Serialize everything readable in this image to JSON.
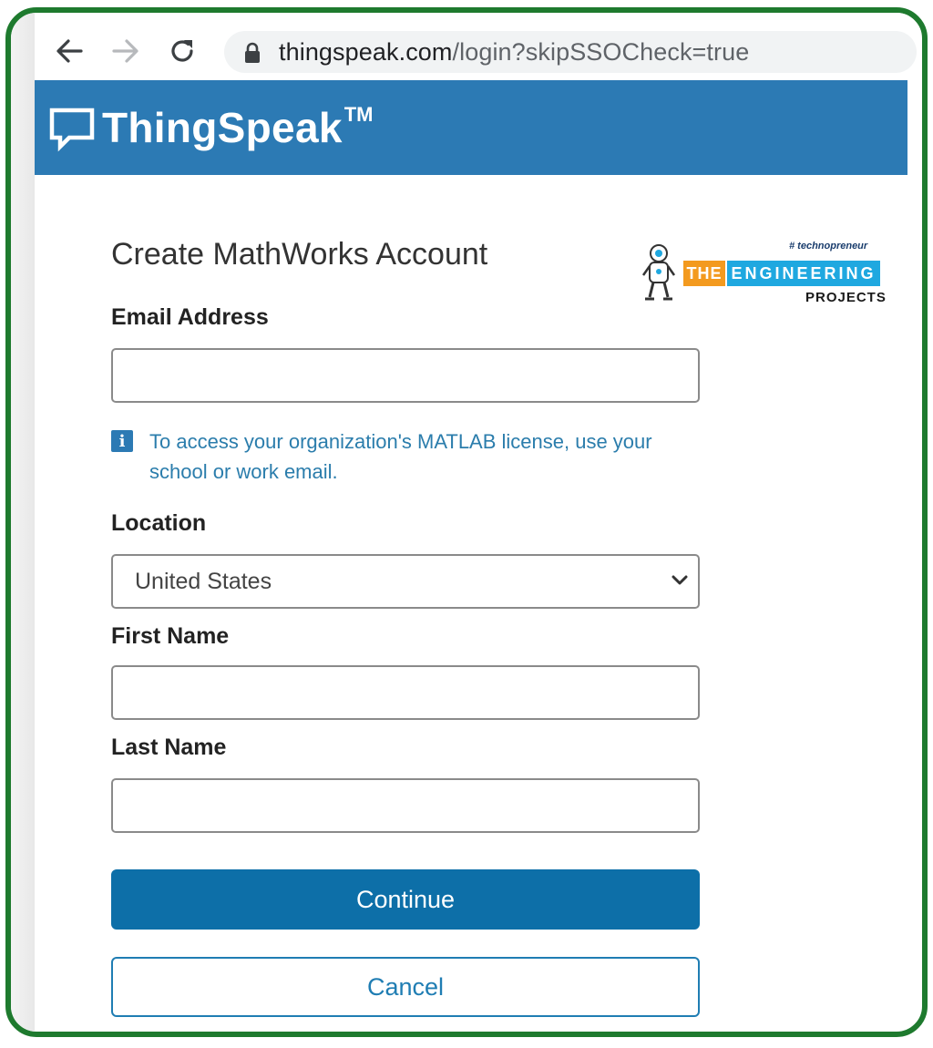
{
  "browser": {
    "url_host": "thingspeak.com",
    "url_path": "/login?skipSSOCheck=true"
  },
  "header": {
    "brand": "ThingSpeak",
    "trademark": "TM",
    "brand_color": "#2c7ab4"
  },
  "form": {
    "title": "Create MathWorks Account",
    "email": {
      "label": "Email Address",
      "value": ""
    },
    "info_text": "To access your organization's MATLAB license, use your school or work email.",
    "location": {
      "label": "Location",
      "value": "United States"
    },
    "first_name": {
      "label": "First Name",
      "value": ""
    },
    "last_name": {
      "label": "Last Name",
      "value": ""
    },
    "continue_label": "Continue",
    "cancel_label": "Cancel",
    "accent_color": "#0d6fa8"
  },
  "watermark": {
    "tag": "# technopreneur",
    "the": "THE",
    "engineering": "ENGINEERING",
    "projects": "PROJECTS"
  },
  "frame_color": "#1e7a2e"
}
